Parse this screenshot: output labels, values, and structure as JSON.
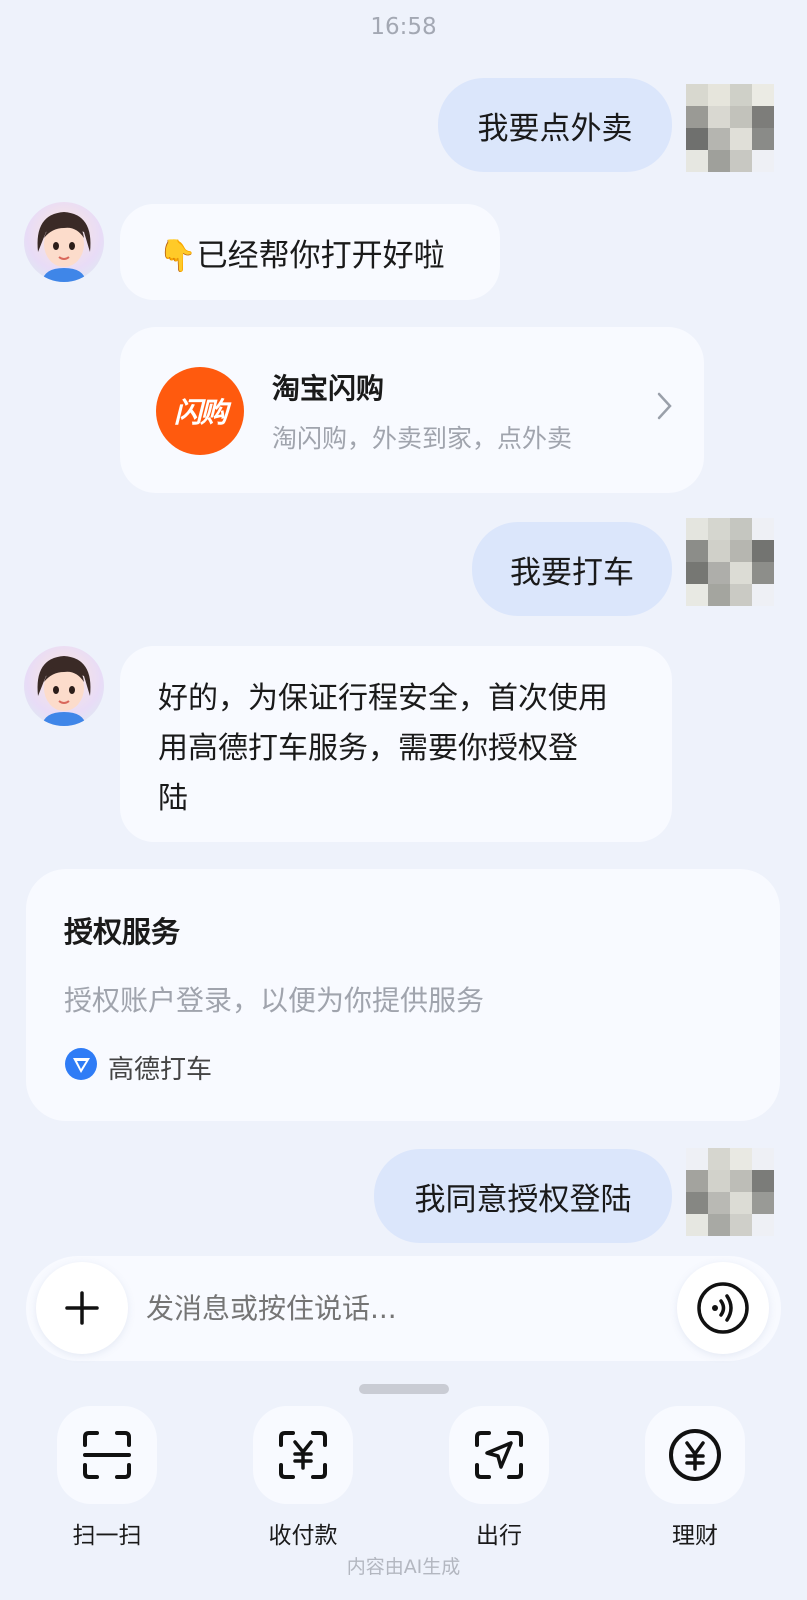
{
  "status": {
    "time": "16:58"
  },
  "messages": {
    "m1": {
      "text": "我要点外卖"
    },
    "m2": {
      "text": "👇已经帮你打开好啦"
    },
    "app_card": {
      "logo_text": "闪购",
      "title": "淘宝闪购",
      "subtitle": "淘闪购，外卖到家，点外卖"
    },
    "m3": {
      "text": "我要打车"
    },
    "m4": {
      "lines": [
        "好的，为保证行程安全，首次使用",
        "用高德打车服务，需要你授权登",
        "陆"
      ]
    },
    "auth_card": {
      "title": "授权服务",
      "description": "授权账户登录，以便为你提供服务",
      "app_name": "高德打车"
    },
    "m5": {
      "text": "我同意授权登陆"
    }
  },
  "composer": {
    "placeholder": "发消息或按住说话..."
  },
  "tools": [
    {
      "label": "扫一扫",
      "icon": "scan-icon"
    },
    {
      "label": "收付款",
      "icon": "payment-icon"
    },
    {
      "label": "出行",
      "icon": "navigation-icon"
    },
    {
      "label": "理财",
      "icon": "finance-icon"
    }
  ],
  "footer": {
    "text": "内容由AI生成"
  },
  "colors": {
    "background": "#eef2fb",
    "user_bubble": "#dbe6fb",
    "ai_bubble": "#f8faff",
    "brand_orange": "#ff5a0e",
    "gaode_blue": "#2f7cf6"
  }
}
